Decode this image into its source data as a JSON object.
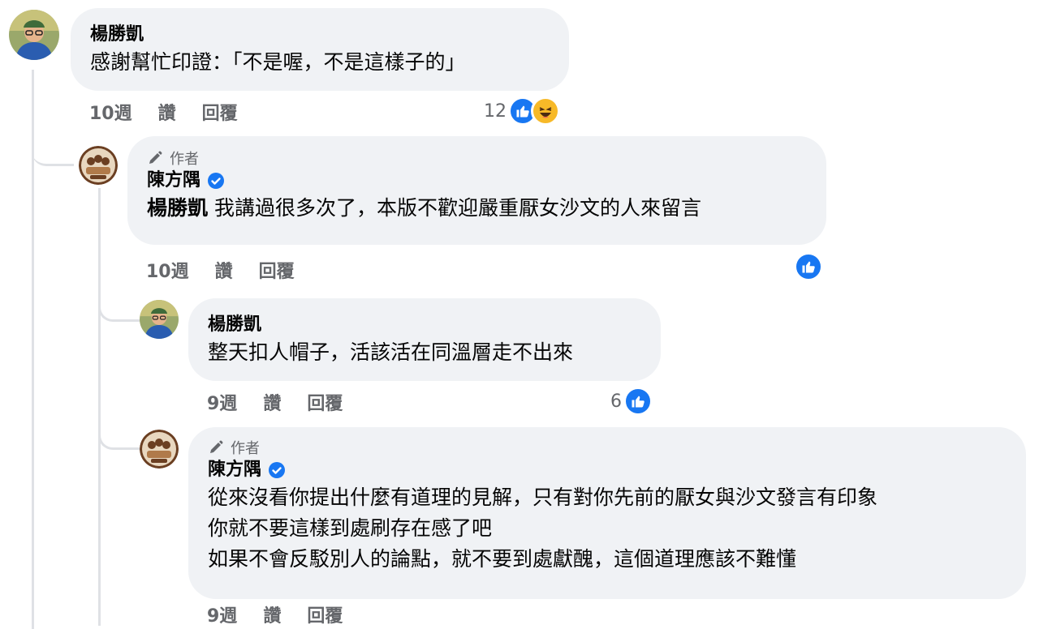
{
  "colors": {
    "accent": "#1877f2",
    "bubble": "#f0f2f5",
    "muted": "#65676b",
    "line": "#dfe1e5"
  },
  "comments": [
    {
      "name": "楊勝凱",
      "text": [
        "感謝幫忙印證：「不是喔，不是這樣子的」"
      ],
      "time": "10週",
      "like": "讚",
      "reply": "回覆",
      "reaction_count": "12",
      "reactions": [
        "like-icon",
        "haha-icon"
      ]
    },
    {
      "author_tag": "作者",
      "name": "陳方隅",
      "verified": true,
      "mention": "楊勝凱",
      "text": [
        " 我講過很多次了，本版不歡迎嚴重厭女沙文的人來留言"
      ],
      "time": "10週",
      "like": "讚",
      "reply": "回覆",
      "reaction_count": "",
      "reactions": [
        "like-icon"
      ]
    },
    {
      "name": "楊勝凱",
      "text": [
        "整天扣人帽子，活該活在同溫層走不出來"
      ],
      "time": "9週",
      "like": "讚",
      "reply": "回覆",
      "reaction_count": "6",
      "reactions": [
        "like-icon"
      ]
    },
    {
      "author_tag": "作者",
      "name": "陳方隅",
      "verified": true,
      "text": [
        "從來沒看你提出什麼有道理的見解，只有對你先前的厭女與沙文發言有印象",
        "你就不要這樣到處刷存在感了吧",
        "如果不會反駁別人的論點，就不要到處獻醜，這個道理應該不難懂"
      ],
      "time": "9週",
      "like": "讚",
      "reply": "回覆"
    }
  ]
}
